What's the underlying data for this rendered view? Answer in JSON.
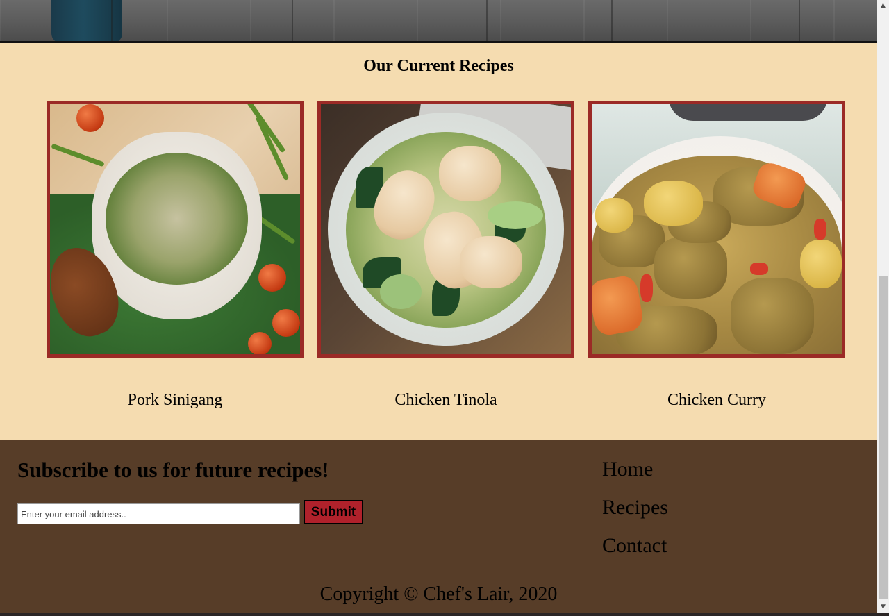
{
  "recipes_section": {
    "heading": "Our Current Recipes",
    "items": [
      {
        "title": "Pork Sinigang"
      },
      {
        "title": "Chicken Tinola"
      },
      {
        "title": "Chicken Curry"
      }
    ]
  },
  "footer": {
    "subscribe_heading": "Subscribe to us for future recipes!",
    "email_placeholder": "Enter your email address..",
    "submit_label": "Submit",
    "nav": [
      "Home",
      "Recipes",
      "Contact"
    ],
    "copyright": "Copyright © Chef's Lair, 2020"
  },
  "colors": {
    "section_bg": "#f5dcb0",
    "footer_bg": "#573d28",
    "card_border": "#9b2a26",
    "submit_bg": "#b0212b"
  },
  "icons": {
    "scroll_up": "scroll-up-arrow-icon",
    "scroll_down": "scroll-down-arrow-icon"
  }
}
